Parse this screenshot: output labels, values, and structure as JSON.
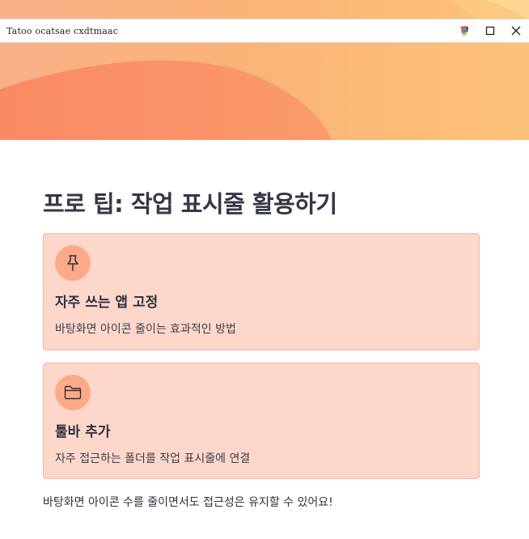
{
  "window": {
    "title": "Tatoo ocatsae cxdtmaac"
  },
  "main": {
    "title": "프로 팁: 작업 표시줄 활용하기",
    "cards": [
      {
        "icon": "pin-icon",
        "title": "자주 쓰는 앱 고정",
        "description": "바탕화면 아이콘 줄이는 효과적인 방법"
      },
      {
        "icon": "folder-icon",
        "title": "툴바 추가",
        "description": "자주 접근하는 폴더를 작업 표시줄에 연결"
      }
    ],
    "footer": "바탕화면 아이콘 수를 줄이면서도 접근성은 유지할 수 있어요!"
  },
  "colors": {
    "hero_light": "#fcc072",
    "hero_dark": "#fa8e66",
    "card_bg": "#fed7cb",
    "card_border": "#efb9a9",
    "icon_bg": "#fcaa8a",
    "title_text": "#343746"
  }
}
